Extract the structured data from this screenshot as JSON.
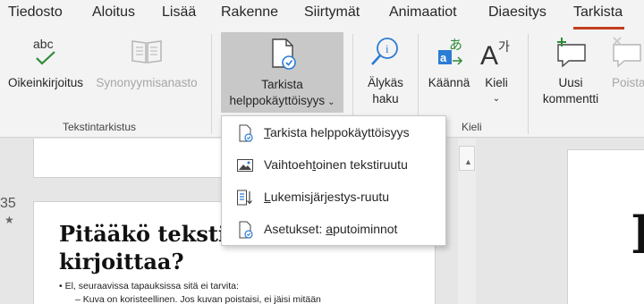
{
  "tabs": [
    {
      "label": "Tiedosto"
    },
    {
      "label": "Aloitus"
    },
    {
      "label": "Lisää"
    },
    {
      "label": "Rakenne"
    },
    {
      "label": "Siirtymät"
    },
    {
      "label": "Animaatiot"
    },
    {
      "label": "Diaesitys"
    },
    {
      "label": "Tarkista",
      "active": true
    }
  ],
  "ribbon": {
    "spelling": {
      "label": "Oikeinkirjoitus",
      "icon_text": "abc"
    },
    "thesaurus": {
      "label": "Synonyymisanasto",
      "disabled": true
    },
    "proofing_group": "Tekstintarkistus",
    "accessibility": {
      "line1": "Tarkista",
      "line2": "helppokäyttöisyys",
      "chevron": "⌄"
    },
    "smart_lookup": {
      "line1": "Älykäs",
      "line2": "haku"
    },
    "translate": {
      "label": "Käännä"
    },
    "language": {
      "label": "Kieli",
      "chevron": "⌄"
    },
    "language_group": "Kieli",
    "new_comment": {
      "line1": "Uusi",
      "line2": "kommentti"
    },
    "delete_comment": {
      "label": "Poista",
      "disabled": true
    }
  },
  "menu": {
    "items": [
      {
        "pre": "",
        "mnemonic": "T",
        "post": "arkista helppokäyttöisyys"
      },
      {
        "pre": "Vaihtoeh",
        "mnemonic": "t",
        "post": "oinen tekstiruutu"
      },
      {
        "pre": "",
        "mnemonic": "L",
        "post": "ukemisjärjestys-ruutu"
      },
      {
        "pre": "Asetukset: ",
        "mnemonic": "a",
        "post": "putoiminnot"
      }
    ]
  },
  "slides": {
    "number": "35",
    "star": "★",
    "title_line1": "Pitääkö tekstiv",
    "title_line2": "kirjoittaa?",
    "bullet": "•   El, seuraavissa tapauksissa sitä ei tarvita:",
    "sub_bullet": "–  Kuva on koristeellinen. Jos kuvan poistaisi, ei jäisi mitään",
    "editor_letter": "I"
  },
  "colors": {
    "accent": "#c43e1c",
    "menu_bg": "#ffffff",
    "ribbon_bg": "#f3f3f3",
    "icon_blue": "#2b7cd3"
  }
}
